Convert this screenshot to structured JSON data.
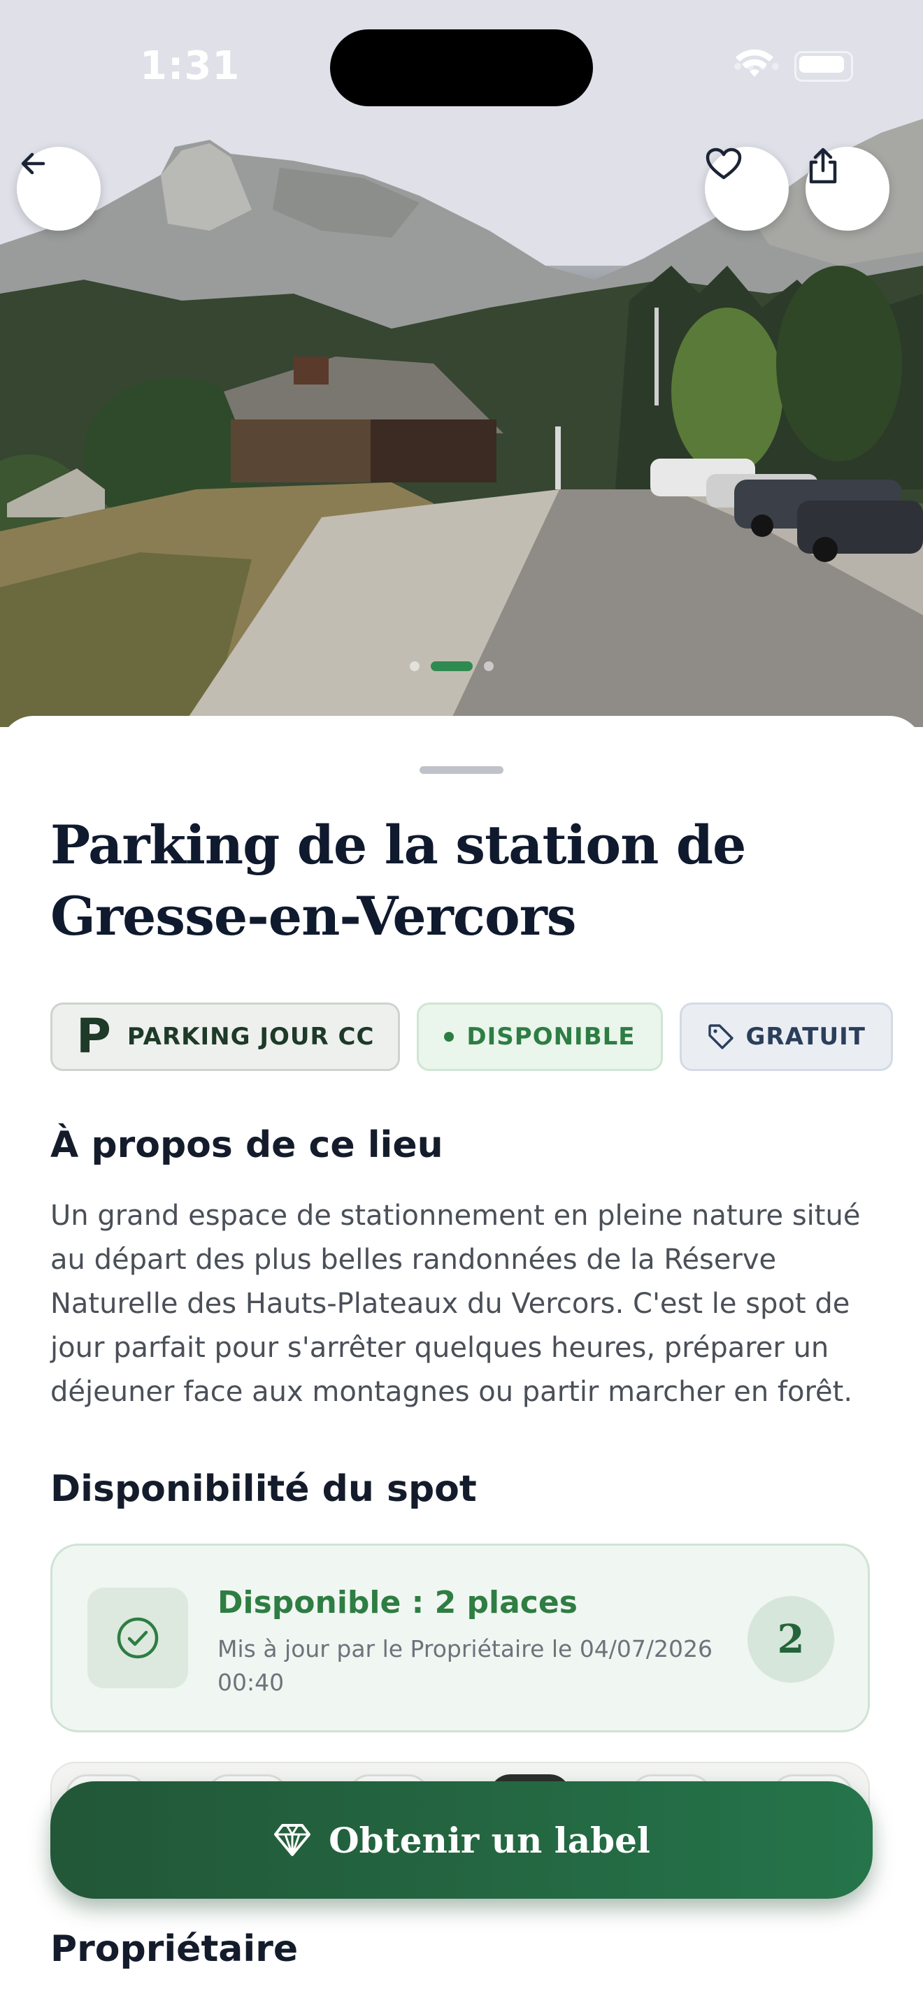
{
  "status_bar": {
    "time": "1:31"
  },
  "hero": {
    "back_icon": "arrow-left-icon",
    "favorite_icon": "heart-icon",
    "share_icon": "share-icon",
    "pager": {
      "count": 3,
      "active_index": 1
    }
  },
  "place": {
    "title": "Parking de la station de Gresse-en-Vercors",
    "tags": {
      "type_letter": "P",
      "type_label": "PARKING JOUR CC",
      "status_label": "DISPONIBLE",
      "price_label": "GRATUIT"
    }
  },
  "about": {
    "heading": "À propos de ce lieu",
    "text": "Un grand espace de stationnement en pleine nature situé au départ des plus belles randonnées de la Réserve Naturelle des Hauts-Plateaux du Vercors. C'est le spot de jour parfait pour s'arrêter quelques heures, préparer un déjeuner face aux montagnes ou partir marcher en forêt."
  },
  "availability": {
    "heading": "Disponibilité du spot",
    "title": "Disponible : 2 places",
    "subtitle": "Mis à jour par le Propriétaire le 04/07/2026 00:40",
    "count": "2"
  },
  "cta": {
    "label": "Obtenir un label",
    "icon": "diamond-icon"
  },
  "owner": {
    "heading": "Propriétaire"
  },
  "colors": {
    "brand_green": "#25744a",
    "status_green": "#2e7d43",
    "text_dark": "#101a2e"
  }
}
